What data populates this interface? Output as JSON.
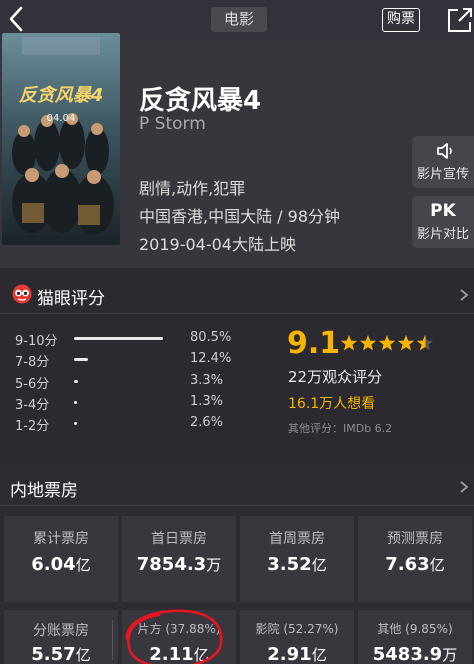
{
  "topbar": {
    "tag": "电影",
    "buy_label": "购票",
    "back_icon": "chevron-left-icon",
    "share_icon": "share-icon"
  },
  "movie": {
    "title": "反贪风暴4",
    "english_title": "P Storm",
    "genres": "剧情,动作,犯罪",
    "region_duration": "中国香港,中国大陆 / 98分钟",
    "release": "2019-04-04大陆上映",
    "poster": {
      "title_text": "反贪风暴4",
      "date_text": "04.04"
    }
  },
  "side_buttons": [
    {
      "icon": "speaker-icon",
      "icon_text": "◁ꞁ",
      "label": "影片宣传"
    },
    {
      "icon_text": "PK",
      "label": "影片对比"
    }
  ],
  "rating": {
    "title": "猫眼评分",
    "distribution": [
      {
        "label": "9-10分",
        "pct": "80.5%",
        "value": 0.805
      },
      {
        "label": "7-8分",
        "pct": "12.4%",
        "value": 0.124
      },
      {
        "label": "5-6分",
        "pct": "3.3%",
        "value": 0.033
      },
      {
        "label": "3-4分",
        "pct": "1.3%",
        "value": 0.013
      },
      {
        "label": "1-2分",
        "pct": "2.6%",
        "value": 0.026
      }
    ],
    "score": "9.1",
    "stars": 4.5,
    "audience": "22万观众评分",
    "want": "16.1万人想看",
    "other": "其他评分：IMDb 6.2",
    "accent": "#f7b500"
  },
  "box_office": {
    "title": "内地票房",
    "cards": [
      {
        "label": "累计票房",
        "value": "6.04",
        "unit": "亿"
      },
      {
        "label": "首日票房",
        "value": "7854.3",
        "unit": "万"
      },
      {
        "label": "首周票房",
        "value": "3.52",
        "unit": "亿"
      },
      {
        "label": "预测票房",
        "value": "7.63",
        "unit": "亿"
      },
      {
        "label": "分账票房",
        "value": "5.57",
        "unit": "亿"
      },
      {
        "label": "片方 (37.88%)",
        "value": "2.11",
        "unit": "亿"
      },
      {
        "label": "影院 (52.27%)",
        "value": "2.91",
        "unit": "亿"
      },
      {
        "label": "其他 (9.85%)",
        "value": "5483.9",
        "unit": "万"
      }
    ]
  }
}
